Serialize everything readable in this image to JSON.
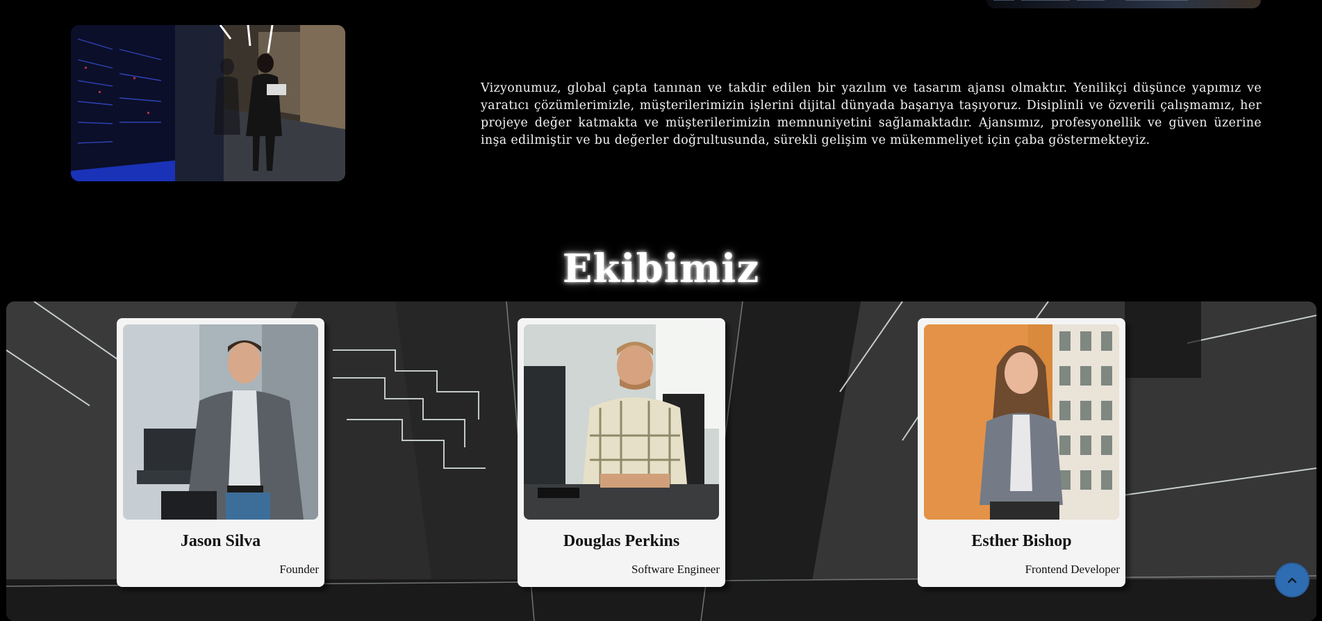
{
  "vision": {
    "paragraph": "Vizyonumuz, global çapta tanınan ve takdir edilen bir yazılım ve tasarım ajansı olmaktır. Yenilikçi düşünce yapımız ve yaratıcı çözümlerimizle, müşterilerimizin işlerini dijital dünyada başarıya taşıyoruz. Disiplinli ve özverili çalışmamız, her projeye değer katmakta ve müşterilerimizin memnuniyetini sağlamaktadır. Ajansımız, profesyonellik ve güven üzerine inşa edilmiştir ve bu değerler doğrultusunda, sürekli gelişim ve mükemmeliyet için çaba göstermekteyiz."
  },
  "team": {
    "heading": "Ekibimiz",
    "members": [
      {
        "name": "Jason Silva",
        "role": "Founder"
      },
      {
        "name": "Douglas Perkins",
        "role": "Software Engineer"
      },
      {
        "name": "Esther Bishop",
        "role": "Frontend Developer"
      }
    ]
  },
  "scroll_top": {
    "icon": "chevron-up-icon"
  },
  "colors": {
    "background": "#000000",
    "card": "#f4f4f4",
    "scroll_button": "#2f6db3",
    "text": "#f2f2f2"
  }
}
